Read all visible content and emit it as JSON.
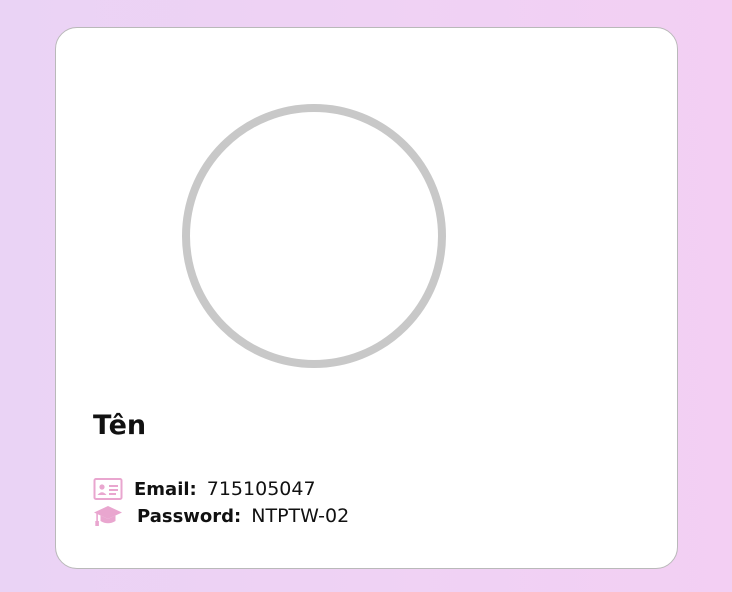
{
  "profile": {
    "name": "Tên",
    "email_label": "Email",
    "email_value": "715105047",
    "password_label": "Password",
    "password_value": "NTPTW-02",
    "separator": ":"
  },
  "icons": {
    "email": "id-card-icon",
    "password": "graduation-cap-icon"
  },
  "colors": {
    "icon": "#e9a6cf",
    "avatar_border": "#c8c8c8",
    "card_bg": "#ffffff"
  }
}
